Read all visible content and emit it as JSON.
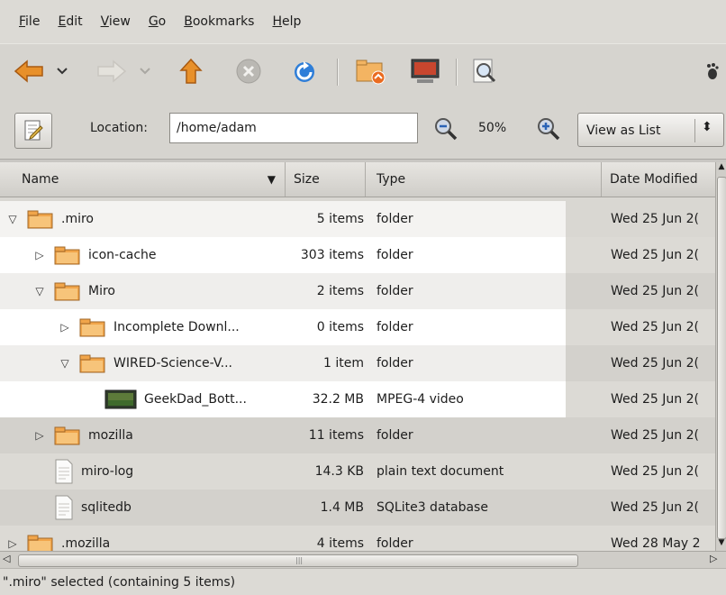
{
  "menu": [
    {
      "u": "F",
      "rest": "ile"
    },
    {
      "u": "E",
      "rest": "dit"
    },
    {
      "u": "V",
      "rest": "iew"
    },
    {
      "u": "G",
      "rest": "o"
    },
    {
      "u": "B",
      "rest": "ookmarks"
    },
    {
      "u": "H",
      "rest": "elp"
    }
  ],
  "location": {
    "label": "Location:",
    "value": "/home/adam"
  },
  "zoom": "50%",
  "view_mode": "View as List",
  "columns": {
    "name": "Name",
    "size": "Size",
    "type": "Type",
    "date": "Date Modified"
  },
  "rows": [
    {
      "name": ".miro",
      "size": "5 items",
      "type": "folder",
      "date": "Wed 25 Jun 2(",
      "icon": "folder-icon",
      "expander": "expanded",
      "depth": 0
    },
    {
      "name": "icon-cache",
      "size": "303 items",
      "type": "folder",
      "date": "Wed 25 Jun 2(",
      "icon": "folder-icon",
      "expander": "collapsed",
      "depth": 1
    },
    {
      "name": "Miro",
      "size": "2 items",
      "type": "folder",
      "date": "Wed 25 Jun 2(",
      "icon": "folder-icon",
      "expander": "expanded",
      "depth": 1
    },
    {
      "name": "Incomplete Downl...",
      "size": "0 items",
      "type": "folder",
      "date": "Wed 25 Jun 2(",
      "icon": "folder-icon",
      "expander": "collapsed",
      "depth": 2
    },
    {
      "name": "WIRED-Science-V...",
      "size": "1 item",
      "type": "folder",
      "date": "Wed 25 Jun 2(",
      "icon": "folder-icon",
      "expander": "expanded",
      "depth": 2
    },
    {
      "name": "GeekDad_Bott...",
      "size": "32.2 MB",
      "type": "MPEG-4 video",
      "date": "Wed 25 Jun 2(",
      "icon": "video-icon",
      "expander": "none",
      "depth": 3
    },
    {
      "name": "mozilla",
      "size": "11 items",
      "type": "folder",
      "date": "Wed 25 Jun 2(",
      "icon": "folder-icon",
      "expander": "collapsed",
      "depth": 1
    },
    {
      "name": "miro-log",
      "size": "14.3 KB",
      "type": "plain text document",
      "date": "Wed 25 Jun 2(",
      "icon": "document-icon",
      "expander": "none",
      "depth": 1
    },
    {
      "name": "sqlitedb",
      "size": "1.4 MB",
      "type": "SQLite3 database",
      "date": "Wed 25 Jun 2(",
      "icon": "document-icon",
      "expander": "none",
      "depth": 1
    },
    {
      "name": ".mozilla",
      "size": "4 items",
      "type": "folder",
      "date": "Wed 28 May 2",
      "icon": "folder-icon",
      "expander": "collapsed",
      "depth": 0
    }
  ],
  "status": "\".miro\" selected (containing 5 items)"
}
